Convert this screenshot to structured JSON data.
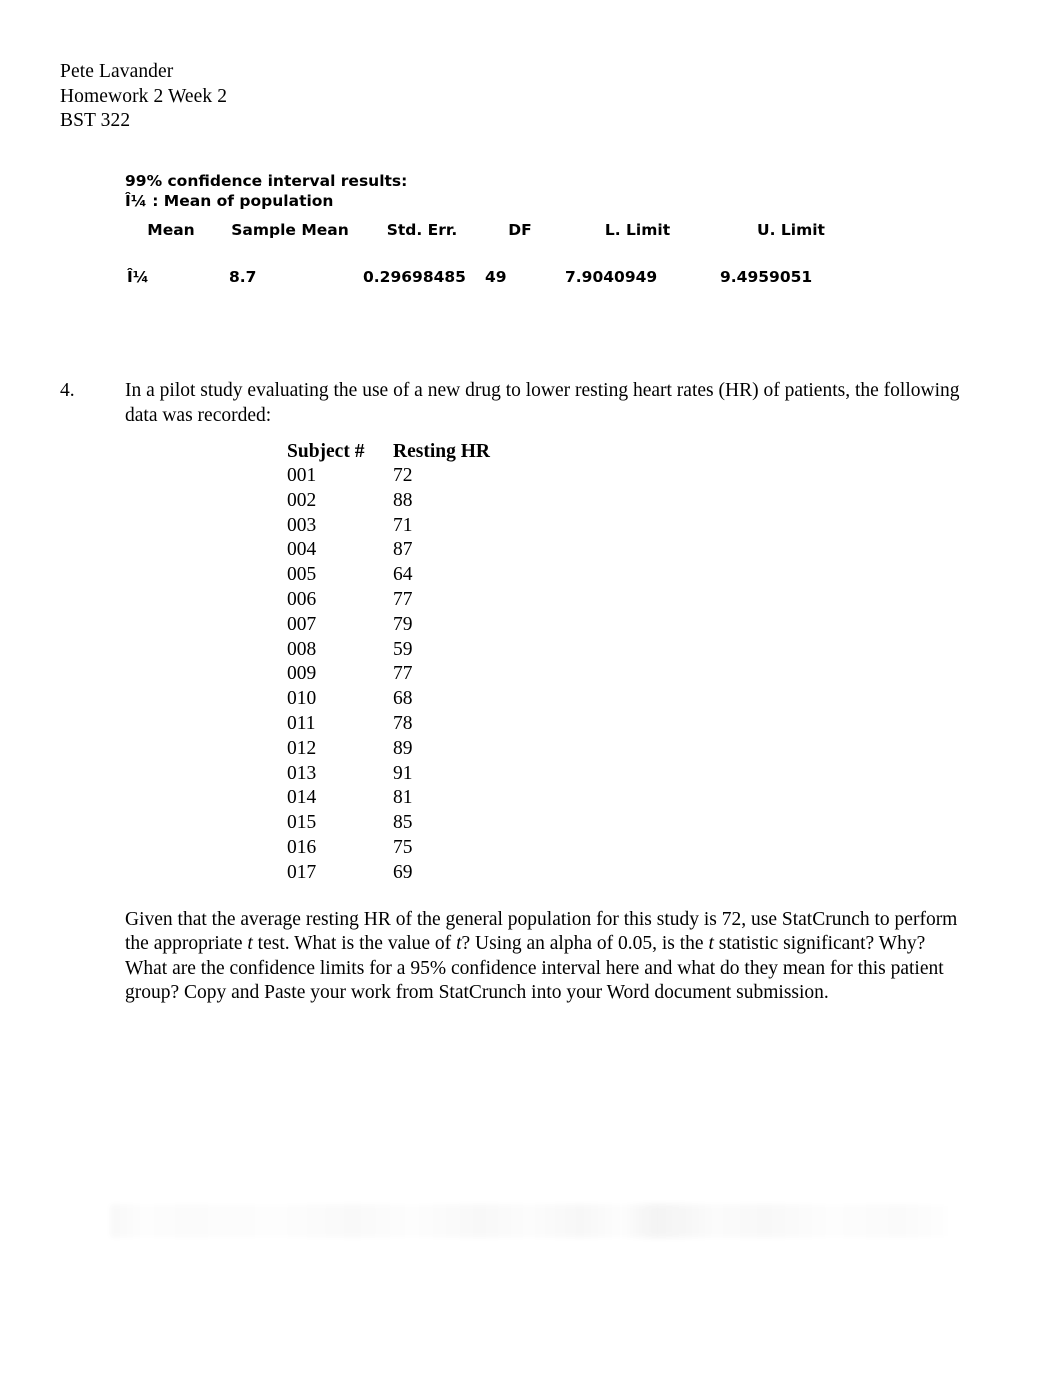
{
  "header": {
    "name": "Pete Lavander",
    "assignment": "Homework 2 Week 2",
    "course": "BST 322"
  },
  "statcrunch": {
    "title": "99% confidence interval results:",
    "parameter_line": "Î¼ : Mean of population",
    "columns": [
      "Mean",
      "Sample Mean",
      "Std. Err.",
      "DF",
      "L. Limit",
      "U. Limit"
    ],
    "column_mean": "Mean",
    "column_sample_mean": "Sample Mean",
    "column_std_err": "Std. Err.",
    "column_df": "DF",
    "column_l_limit": "L. Limit",
    "column_u_limit": "U. Limit",
    "row": {
      "parameter": "Î¼",
      "sample_mean": "8.7",
      "std_err": "0.29698485",
      "df": "49",
      "l_limit": "7.9040949",
      "u_limit": "9.4959051"
    }
  },
  "question": {
    "number": "4.",
    "intro": "In a pilot study evaluating the use of a new drug to lower resting heart rates (HR) of patients, the following data was recorded:",
    "table": {
      "columns": [
        "Subject #",
        "Resting HR"
      ],
      "column_subject": "Subject #",
      "column_resting_hr": "Resting HR",
      "rows": [
        {
          "subject": "001",
          "hr": "72"
        },
        {
          "subject": "002",
          "hr": "88"
        },
        {
          "subject": "003",
          "hr": "71"
        },
        {
          "subject": "004",
          "hr": "87"
        },
        {
          "subject": "005",
          "hr": "64"
        },
        {
          "subject": "006",
          "hr": "77"
        },
        {
          "subject": "007",
          "hr": "79"
        },
        {
          "subject": "008",
          "hr": "59"
        },
        {
          "subject": "009",
          "hr": "77"
        },
        {
          "subject": "010",
          "hr": "68"
        },
        {
          "subject": "011",
          "hr": "78"
        },
        {
          "subject": "012",
          "hr": "89"
        },
        {
          "subject": "013",
          "hr": "91"
        },
        {
          "subject": "014",
          "hr": "81"
        },
        {
          "subject": "015",
          "hr": "85"
        },
        {
          "subject": "016",
          "hr": "75"
        },
        {
          "subject": "017",
          "hr": "69"
        }
      ]
    },
    "outro_part1": "Given that the average resting HR of the general population for this study is 72, use StatCrunch to perform the appropriate ",
    "outro_t1": "t",
    "outro_part2": " test.  What is the value of ",
    "outro_t2": "t",
    "outro_part3": "?  Using an alpha of 0.05, is the ",
    "outro_t3": "t",
    "outro_part4": " statistic significant?  Why?  What are the confidence limits for a 95% confidence interval here and what do they mean for this patient group?  Copy and Paste your work from StatCrunch into your Word document submission."
  }
}
